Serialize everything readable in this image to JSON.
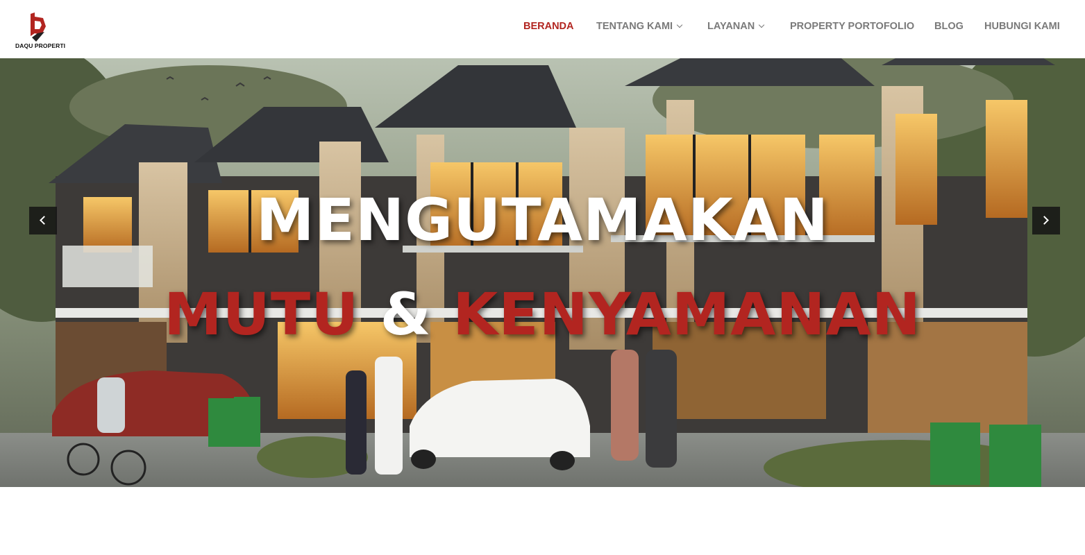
{
  "brand": {
    "name": "DAQU PROPERTI",
    "accent": "#b22520"
  },
  "nav": {
    "items": [
      {
        "label": "BERANDA",
        "active": true,
        "dropdown": false
      },
      {
        "label": "TENTANG KAMI",
        "active": false,
        "dropdown": true
      },
      {
        "label": "LAYANAN",
        "active": false,
        "dropdown": true
      },
      {
        "label": "PROPERTY PORTOFOLIO",
        "active": false,
        "dropdown": false
      },
      {
        "label": "BLOG",
        "active": false,
        "dropdown": false
      },
      {
        "label": "HUBUNGI KAMI",
        "active": false,
        "dropdown": false
      }
    ]
  },
  "hero": {
    "line1": "MENGUTAMAKAN",
    "line2_part1": "MUTU",
    "line2_amp": "&",
    "line2_part2": "KENYAMANAN",
    "prev_icon": "chevron-left-icon",
    "next_icon": "chevron-right-icon"
  }
}
